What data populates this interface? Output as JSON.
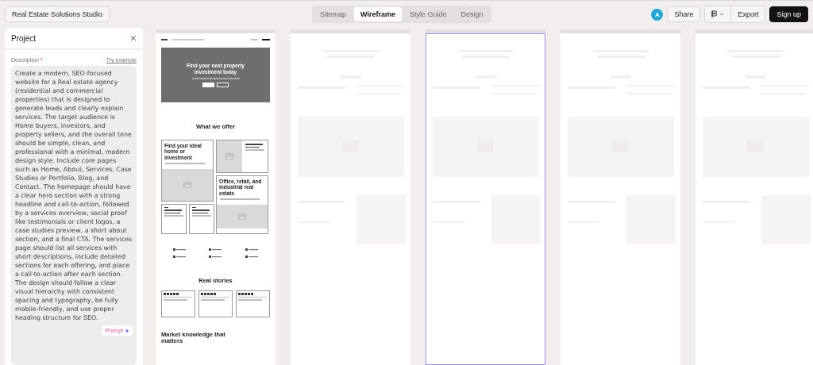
{
  "project_button": "Real Estate Solutions Studio",
  "tabs": [
    {
      "label": "Sitemap",
      "selected": false
    },
    {
      "label": "Wireframe",
      "selected": true
    },
    {
      "label": "Style Guide",
      "selected": false
    },
    {
      "label": "Design",
      "selected": false
    }
  ],
  "account": {
    "avatar": "A",
    "share": "Share",
    "export": "Export",
    "signup": "Sign up"
  },
  "panel": {
    "title": "Project",
    "label": "Description",
    "required_mark": "*",
    "example_link": "Try example",
    "description": "Create a modern, SEO-focused website for a Real estate agency (residential and commercial properties) that is designed to generate leads and clearly explain services. The target audience is Home buyers, investors, and property sellers, and the overall tone should be simple, clean, and professional with a minimal, modern design style. Include core pages such as Home, About, Services, Case Studies or Portfolio, Blog, and Contact. The homepage should have a clear hero section with a strong headline and call-to-action, followed by a services overview, social proof like testimonials or client logos, a case studies preview, a short about section, and a final CTA. The services page should list all services with short descriptions, include detailed sections for each offering, and place a call-to-action after each section. The design should follow a clear visual hierarchy with consistent spacing and typography, be fully mobile-friendly, and use proper heading structure for SEO.",
    "prompt_button": "Prompt"
  },
  "frames": [
    {
      "kind": "full",
      "selected": false
    },
    {
      "kind": "locked",
      "selected": false
    },
    {
      "kind": "locked",
      "selected": true
    },
    {
      "kind": "locked",
      "selected": false
    },
    {
      "kind": "locked",
      "selected": false
    }
  ],
  "home": {
    "hero_title": "Find your next property investment today",
    "section_title": "What we offer",
    "card_1_title": "Find your ideal home or investment",
    "card_2_title": "Office, retail, and industrial real estate",
    "stories_title": "Real stories",
    "testimonials": [
      {
        "stars": 5
      },
      {
        "stars": 5
      },
      {
        "stars": 5
      }
    ],
    "knowledge_title": "Market knowledge that matters"
  }
}
